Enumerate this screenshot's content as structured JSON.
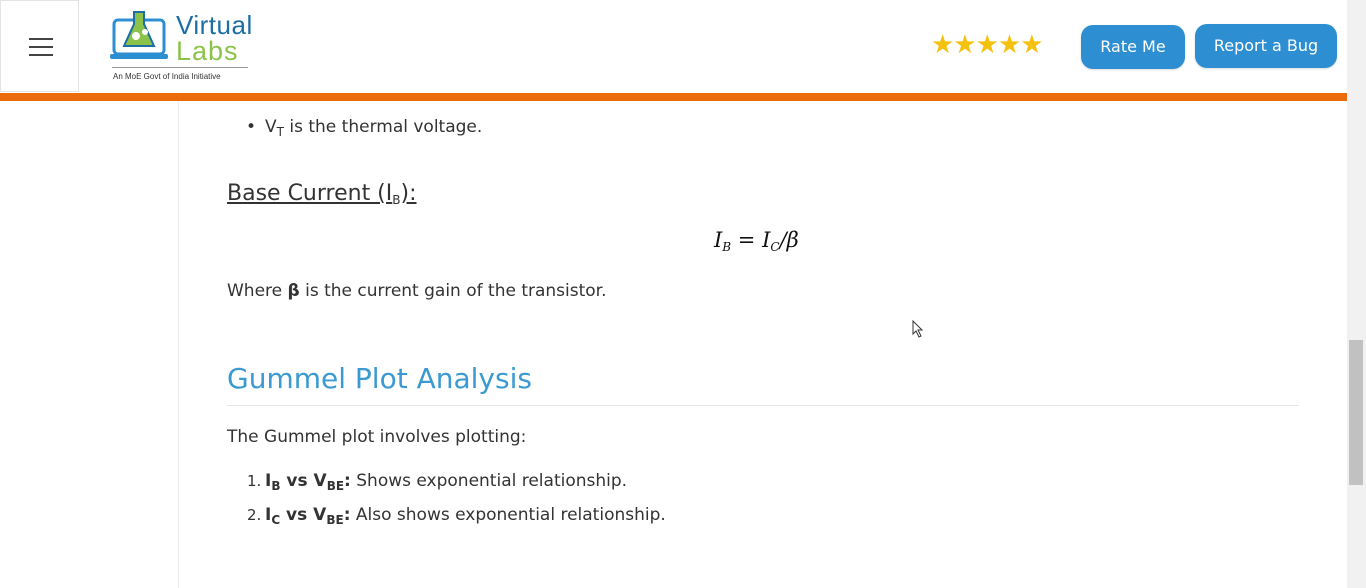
{
  "header": {
    "logo": {
      "word1": "Virtual",
      "word2": "Labs",
      "tagline": "An MoE Govt of India Initiative"
    },
    "stars": "★★★★★",
    "rate_button": "Rate Me",
    "bug_button": "Report a Bug"
  },
  "content": {
    "bullet_vt": {
      "symbol": "V",
      "sub": "T",
      "text": " is the thermal voltage."
    },
    "base_current_heading": {
      "text": "Base Current (I",
      "sub": "B",
      "suffix": "):"
    },
    "equation": {
      "lhs": "I",
      "lhs_sub": "B",
      "eq": " = ",
      "rhs": "I",
      "rhs_sub": "C",
      "rest": "/β"
    },
    "where_text": {
      "prefix": "Where ",
      "beta": "β",
      "suffix": " is the current gain of the transistor."
    },
    "gummel_heading": "Gummel Plot Analysis",
    "gummel_intro": "The Gummel plot involves plotting:",
    "gummel_items": [
      {
        "num": "1.",
        "a": "I",
        "a_sub": "B",
        "vs": " vs V",
        "b_sub": "BE",
        "colon": ":",
        "text": " Shows exponential relationship."
      },
      {
        "num": "2.",
        "a": "I",
        "a_sub": "C",
        "vs": " vs V",
        "b_sub": "BE",
        "colon": ":",
        "text": " Also shows exponential relationship."
      }
    ]
  },
  "colors": {
    "accent_orange": "#ec6b0d",
    "button_blue": "#2d8fd1",
    "heading_blue": "#3a9ad1",
    "star_yellow": "#f4c10f"
  }
}
